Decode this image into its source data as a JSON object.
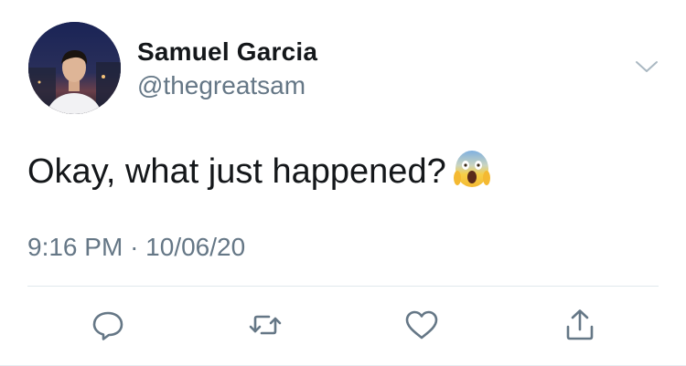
{
  "tweet": {
    "author_name": "Samuel Garcia",
    "author_handle": "@thegreatsam",
    "text": "Okay, what just happened?",
    "emoji": "face-screaming-in-fear",
    "time": "9:16 PM",
    "separator": "·",
    "date": "10/06/20"
  },
  "icons": {
    "more": "chevron-down-icon",
    "reply": "reply-icon",
    "retweet": "retweet-icon",
    "like": "heart-icon",
    "share": "share-icon"
  },
  "colors": {
    "primary_text": "#14171a",
    "secondary_text": "#657786",
    "icon": "#657786",
    "divider": "#e1e8ed"
  }
}
